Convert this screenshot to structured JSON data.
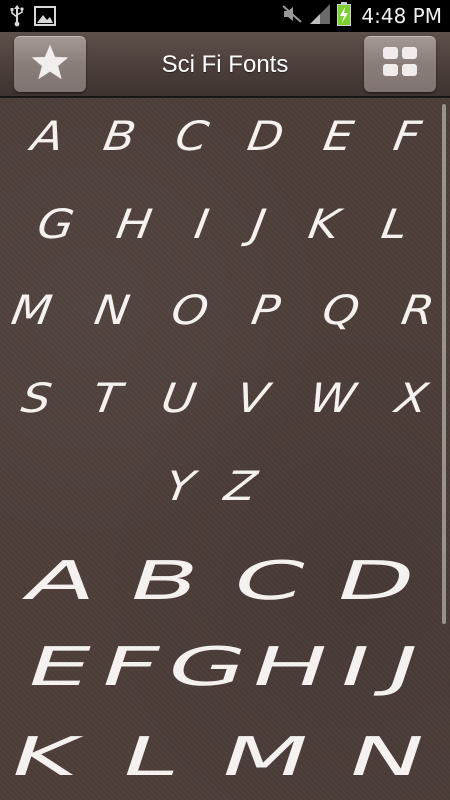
{
  "status_bar": {
    "time": "4:48 PM",
    "icons": [
      "usb-icon",
      "image-icon",
      "mute-icon",
      "signal-icon",
      "battery-charging-icon"
    ]
  },
  "action_bar": {
    "title": "Sci Fi Fonts",
    "left_button_icon": "star-icon",
    "right_button_icon": "grid-icon"
  },
  "content": {
    "rows_small": [
      [
        "A",
        "B",
        "C",
        "D",
        "E",
        "F"
      ],
      [
        "G",
        "H",
        "I",
        "J",
        "K",
        "L"
      ],
      [
        "M",
        "N",
        "O",
        "P",
        "Q",
        "R"
      ],
      [
        "S",
        "T",
        "U",
        "V",
        "W",
        "X"
      ],
      [
        "Y",
        "Z"
      ]
    ],
    "rows_big": [
      [
        "A",
        "B",
        "C",
        "D"
      ],
      [
        "E",
        "F",
        "G",
        "H",
        "I",
        "J"
      ],
      [
        "K",
        "L",
        "M",
        "N"
      ]
    ]
  },
  "colors": {
    "background": "#4d3e3a",
    "action_bar": "#4a3d39",
    "button": "#8a7e79",
    "text": "#f4f1ee"
  }
}
